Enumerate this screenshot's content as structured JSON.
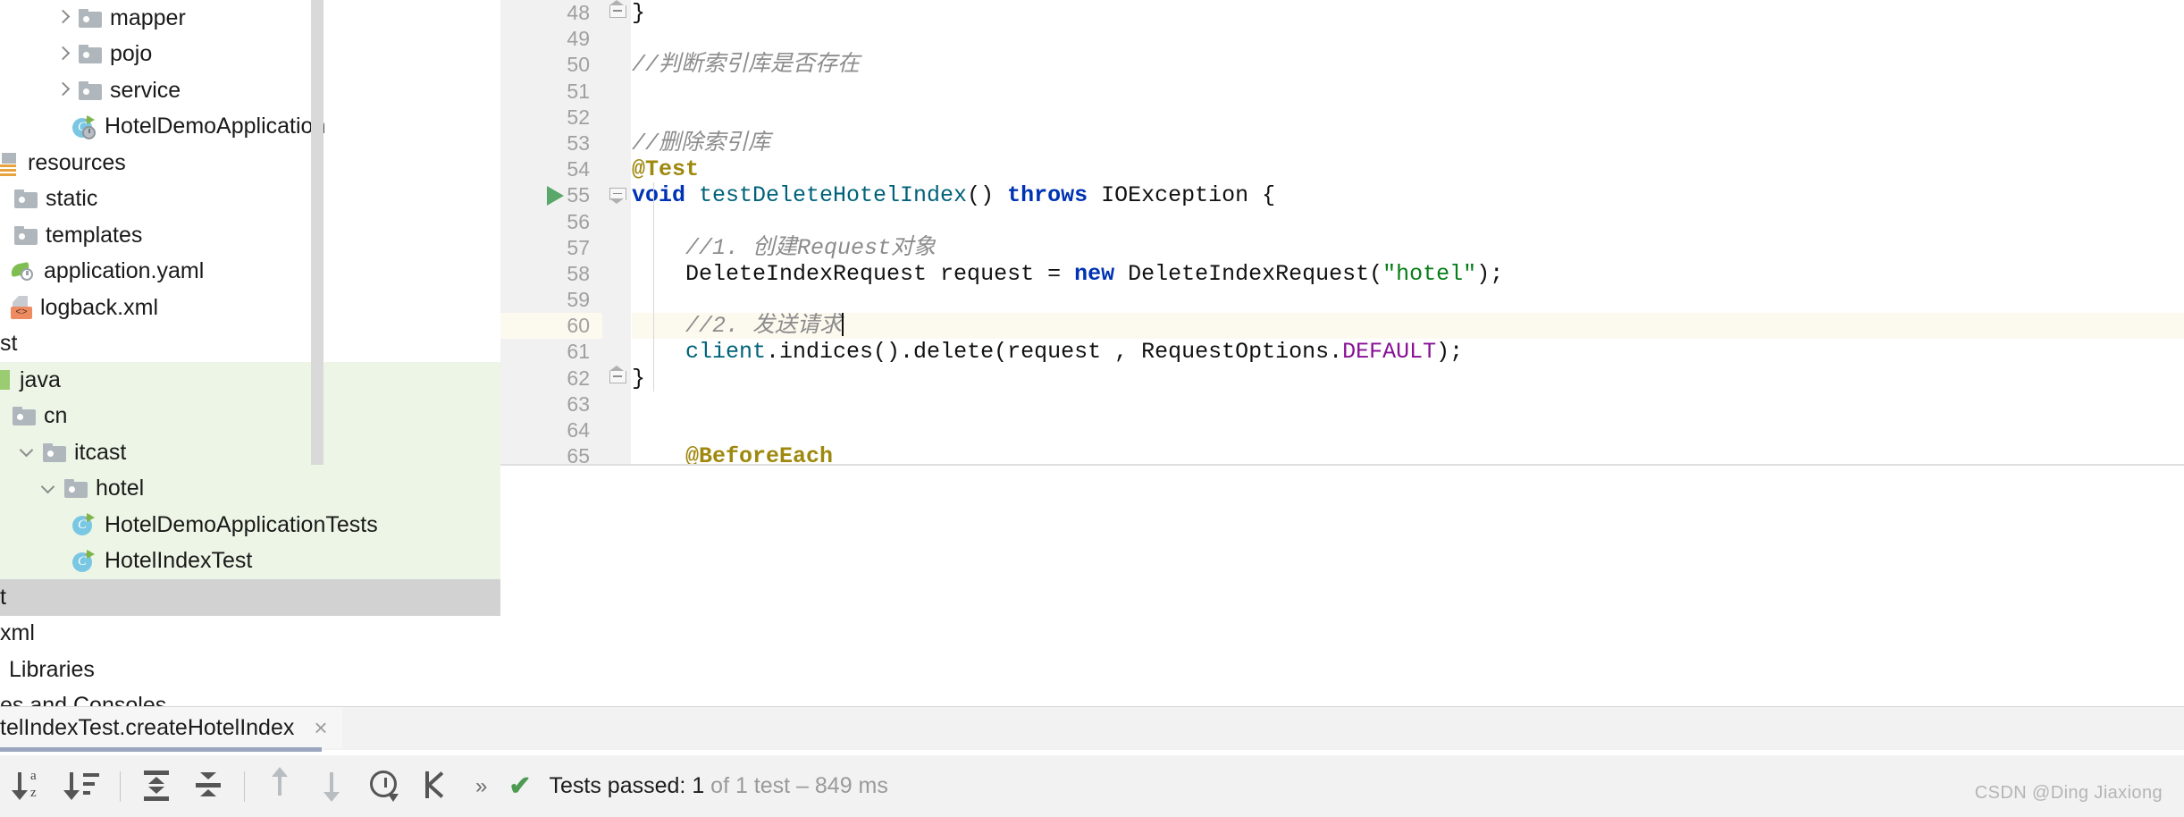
{
  "project_tree": {
    "items": [
      {
        "label": "mapper",
        "icon": "folder-icon",
        "chevron": "right",
        "indent": 60,
        "state": "normal"
      },
      {
        "label": "pojo",
        "icon": "folder-icon",
        "chevron": "right",
        "indent": 60,
        "state": "normal"
      },
      {
        "label": "service",
        "icon": "folder-icon",
        "chevron": "right",
        "indent": 60,
        "state": "normal"
      },
      {
        "label": "HotelDemoApplication",
        "icon": "java-class-run-icon",
        "chevron": "none",
        "indent": 80,
        "state": "normal"
      },
      {
        "label": "resources",
        "icon": "resources-root-icon",
        "chevron": "none",
        "indent": 0,
        "state": "normal"
      },
      {
        "label": "static",
        "icon": "folder-icon",
        "chevron": "none",
        "indent": 16,
        "state": "normal"
      },
      {
        "label": "templates",
        "icon": "folder-icon",
        "chevron": "none",
        "indent": 16,
        "state": "normal"
      },
      {
        "label": "application.yaml",
        "icon": "spring-yaml-icon",
        "chevron": "none",
        "indent": 12,
        "state": "normal"
      },
      {
        "label": "logback.xml",
        "icon": "xml-file-icon",
        "chevron": "none",
        "indent": 12,
        "state": "normal"
      },
      {
        "label": "st",
        "icon": "none",
        "chevron": "none",
        "indent": 0,
        "state": "normal"
      },
      {
        "label": "java",
        "icon": "java-source-root-icon",
        "chevron": "none",
        "indent": 0,
        "state": "selected-green"
      },
      {
        "label": "cn",
        "icon": "folder-icon",
        "chevron": "none",
        "indent": 14,
        "state": "selected-green"
      },
      {
        "label": "itcast",
        "icon": "folder-icon",
        "chevron": "down",
        "indent": 20,
        "state": "selected-green"
      },
      {
        "label": "hotel",
        "icon": "folder-icon",
        "chevron": "down",
        "indent": 44,
        "state": "selected-green"
      },
      {
        "label": "HotelDemoApplicationTests",
        "icon": "java-class-icon",
        "chevron": "none",
        "indent": 80,
        "state": "selected-green"
      },
      {
        "label": "HotelIndexTest",
        "icon": "java-class-icon",
        "chevron": "none",
        "indent": 80,
        "state": "selected-green"
      },
      {
        "label": "t",
        "icon": "none",
        "chevron": "none",
        "indent": 0,
        "state": "selected-gray"
      },
      {
        "label": "xml",
        "icon": "none",
        "chevron": "none",
        "indent": 0,
        "state": "normal"
      },
      {
        "label": "Libraries",
        "icon": "none",
        "chevron": "none",
        "indent": 10,
        "state": "normal"
      },
      {
        "label": "es and Consoles",
        "icon": "none",
        "chevron": "none",
        "indent": 0,
        "state": "normal"
      }
    ]
  },
  "editor": {
    "first_line_number": 48,
    "highlighted_line": 60,
    "run_marker_line": 55,
    "lines": [
      {
        "n": 48,
        "fold": "tip-up",
        "tokens": [
          {
            "t": "}",
            "c": "plain"
          }
        ]
      },
      {
        "n": 49,
        "fold": "none",
        "tokens": []
      },
      {
        "n": 50,
        "fold": "none",
        "tokens": [
          {
            "t": "//判断索引库是否存在",
            "c": "cmt"
          }
        ]
      },
      {
        "n": 51,
        "fold": "none",
        "tokens": []
      },
      {
        "n": 52,
        "fold": "none",
        "tokens": []
      },
      {
        "n": 53,
        "fold": "none",
        "tokens": [
          {
            "t": "//删除索引库",
            "c": "cmt"
          }
        ]
      },
      {
        "n": 54,
        "fold": "none",
        "tokens": [
          {
            "t": "@Test",
            "c": "ann"
          }
        ]
      },
      {
        "n": 55,
        "fold": "tip-down",
        "tokens": [
          {
            "t": "void ",
            "c": "kw"
          },
          {
            "t": "testDeleteHotelIndex",
            "c": "mtd"
          },
          {
            "t": "() ",
            "c": "plain"
          },
          {
            "t": "throws ",
            "c": "kw"
          },
          {
            "t": "IOException {",
            "c": "plain"
          }
        ]
      },
      {
        "n": 56,
        "fold": "none",
        "tokens": []
      },
      {
        "n": 57,
        "fold": "none",
        "tokens": [
          {
            "t": "    //1. 创建Request对象",
            "c": "cmt"
          }
        ]
      },
      {
        "n": 58,
        "fold": "none",
        "tokens": [
          {
            "t": "    DeleteIndexRequest request = ",
            "c": "plain"
          },
          {
            "t": "new ",
            "c": "kw"
          },
          {
            "t": "DeleteIndexRequest(",
            "c": "plain"
          },
          {
            "t": "\"hotel\"",
            "c": "str"
          },
          {
            "t": ");",
            "c": "plain"
          }
        ]
      },
      {
        "n": 59,
        "fold": "none",
        "tokens": []
      },
      {
        "n": 60,
        "fold": "none",
        "tokens": [
          {
            "t": "    //2. 发送请求",
            "c": "cmt"
          }
        ],
        "caret": true
      },
      {
        "n": 61,
        "fold": "none",
        "tokens": [
          {
            "t": "    client",
            "c": "mtd"
          },
          {
            "t": ".indices().delete(request , RequestOptions.",
            "c": "plain"
          },
          {
            "t": "DEFAULT",
            "c": "fld"
          },
          {
            "t": ");",
            "c": "plain"
          }
        ]
      },
      {
        "n": 62,
        "fold": "tip-up",
        "tokens": [
          {
            "t": "}",
            "c": "plain"
          }
        ]
      },
      {
        "n": 63,
        "fold": "none",
        "tokens": []
      },
      {
        "n": 64,
        "fold": "none",
        "tokens": []
      },
      {
        "n": 65,
        "fold": "none",
        "tokens": [
          {
            "t": "    @BeforeEach",
            "c": "ann"
          }
        ]
      }
    ]
  },
  "run_panel": {
    "tab_label": "telIndexTest.createHotelIndex",
    "tab_close": "×",
    "toolbar": [
      {
        "name": "sort-alphabetically-button",
        "icon": "sort-az-icon"
      },
      {
        "name": "sort-by-duration-button",
        "icon": "sort-duration-icon"
      },
      {
        "name": "expand-all-button",
        "icon": "expand-all-icon"
      },
      {
        "name": "collapse-all-button",
        "icon": "collapse-all-icon"
      },
      {
        "name": "previous-failed-test-button",
        "icon": "arrow-up-icon"
      },
      {
        "name": "next-failed-test-button",
        "icon": "arrow-down-icon"
      },
      {
        "name": "show-history-button",
        "icon": "clock-icon"
      },
      {
        "name": "scroll-to-source-button",
        "icon": "scroll-to-source-icon"
      },
      {
        "name": "more-options-button",
        "icon": "chevron-double-right-icon"
      }
    ],
    "more_glyph": "»",
    "status": {
      "check_glyph": "✔",
      "label": "Tests passed: ",
      "count": "1",
      "detail": " of 1 test – 849 ms"
    }
  },
  "watermark": "CSDN @Ding Jiaxiong",
  "colors": {
    "selection_green": "#edf6e6",
    "selection_gray": "#d2d2d2",
    "gutter_bg": "#f1f1f1",
    "highlight_line": "#fcfaef",
    "keyword": "#0033b3",
    "annotation": "#9e880d",
    "comment": "#8c8c8c",
    "string": "#067d17",
    "static_field": "#871094",
    "method": "#00627a",
    "pass_green": "#4e9a51",
    "run_green": "#59a869",
    "tab_underline": "#9aa7bf"
  }
}
